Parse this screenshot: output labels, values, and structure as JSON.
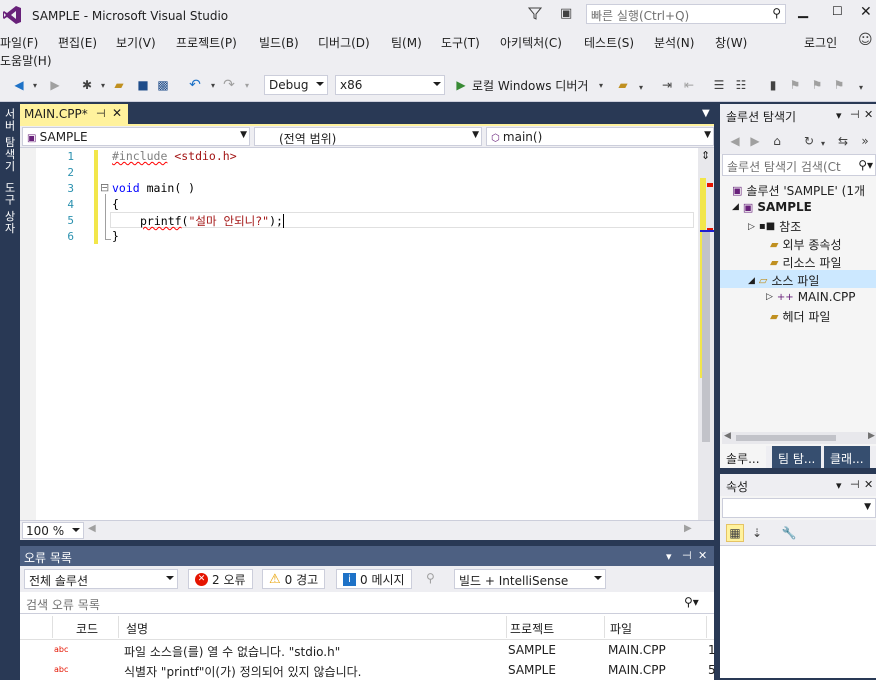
{
  "window": {
    "title": "SAMPLE - Microsoft Visual Studio",
    "quick_launch": "빠른 실행(Ctrl+Q)"
  },
  "menu": {
    "items": [
      "파일(F)",
      "편집(E)",
      "보기(V)",
      "프로젝트(P)",
      "빌드(B)",
      "디버그(D)",
      "팀(M)",
      "도구(T)",
      "아키텍처(C)",
      "테스트(S)",
      "분석(N)",
      "창(W)"
    ],
    "help": "도움말(H)",
    "login": "로그인"
  },
  "toolbar": {
    "config": "Debug",
    "platform": "x86",
    "run_label": "로컬 Windows 디버거"
  },
  "side_strip": {
    "server_explorer": "서버 탐색기",
    "toolbox": "도구 상자"
  },
  "editor": {
    "tab_title": "MAIN.CPP*",
    "nav": {
      "project": "SAMPLE",
      "scope": "(전역 범위)",
      "member": "main()"
    },
    "line_numbers": [
      "1",
      "2",
      "3",
      "4",
      "5",
      "6"
    ],
    "lines": {
      "l1_pp": "#include",
      "l1_hdr": " <stdio.h>",
      "l3_kw": "void",
      "l3_rest": " main( )",
      "l4": "{",
      "l5_fn": "printf",
      "l5_open": "(",
      "l5_str": "\"설마 안되니?\"",
      "l5_close": ");",
      "l6": "}"
    },
    "zoom": "100 %"
  },
  "error_list": {
    "title": "오류 목록",
    "scope": "전체 솔루션",
    "errors_btn": "2 오류",
    "warnings_btn": "0 경고",
    "messages_btn": "0 메시지",
    "build_filter": "빌드 + IntelliSense",
    "search_placeholder": "검색 오류 목록",
    "columns": {
      "code": "코드",
      "desc": "설명",
      "project": "프로젝트",
      "file": "파일"
    },
    "rows": [
      {
        "desc": "파일 소스을(를) 열 수 없습니다. \"stdio.h\"",
        "project": "SAMPLE",
        "file": "MAIN.CPP",
        "line": "1"
      },
      {
        "desc": "식별자 \"printf\"이(가) 정의되어 있지 않습니다.",
        "project": "SAMPLE",
        "file": "MAIN.CPP",
        "line": "5"
      }
    ]
  },
  "solution_explorer": {
    "title": "솔루션 탐색기",
    "search_placeholder": "솔루션 탐색기 검색(Ct",
    "items": [
      {
        "label": "솔루션 'SAMPLE' (1개"
      },
      {
        "label": "SAMPLE"
      },
      {
        "label": "참조"
      },
      {
        "label": "외부 종속성"
      },
      {
        "label": "리소스 파일"
      },
      {
        "label": "소스 파일"
      },
      {
        "label": "MAIN.CPP"
      },
      {
        "label": "헤더 파일"
      }
    ],
    "tabs": [
      "솔루... ",
      "팀 탐...",
      "클래..."
    ]
  },
  "properties": {
    "title": "속성"
  },
  "colors": {
    "accent": "#68217a",
    "tab_active": "#fff29d",
    "error": "#e51400",
    "keyword": "#0000ff"
  }
}
